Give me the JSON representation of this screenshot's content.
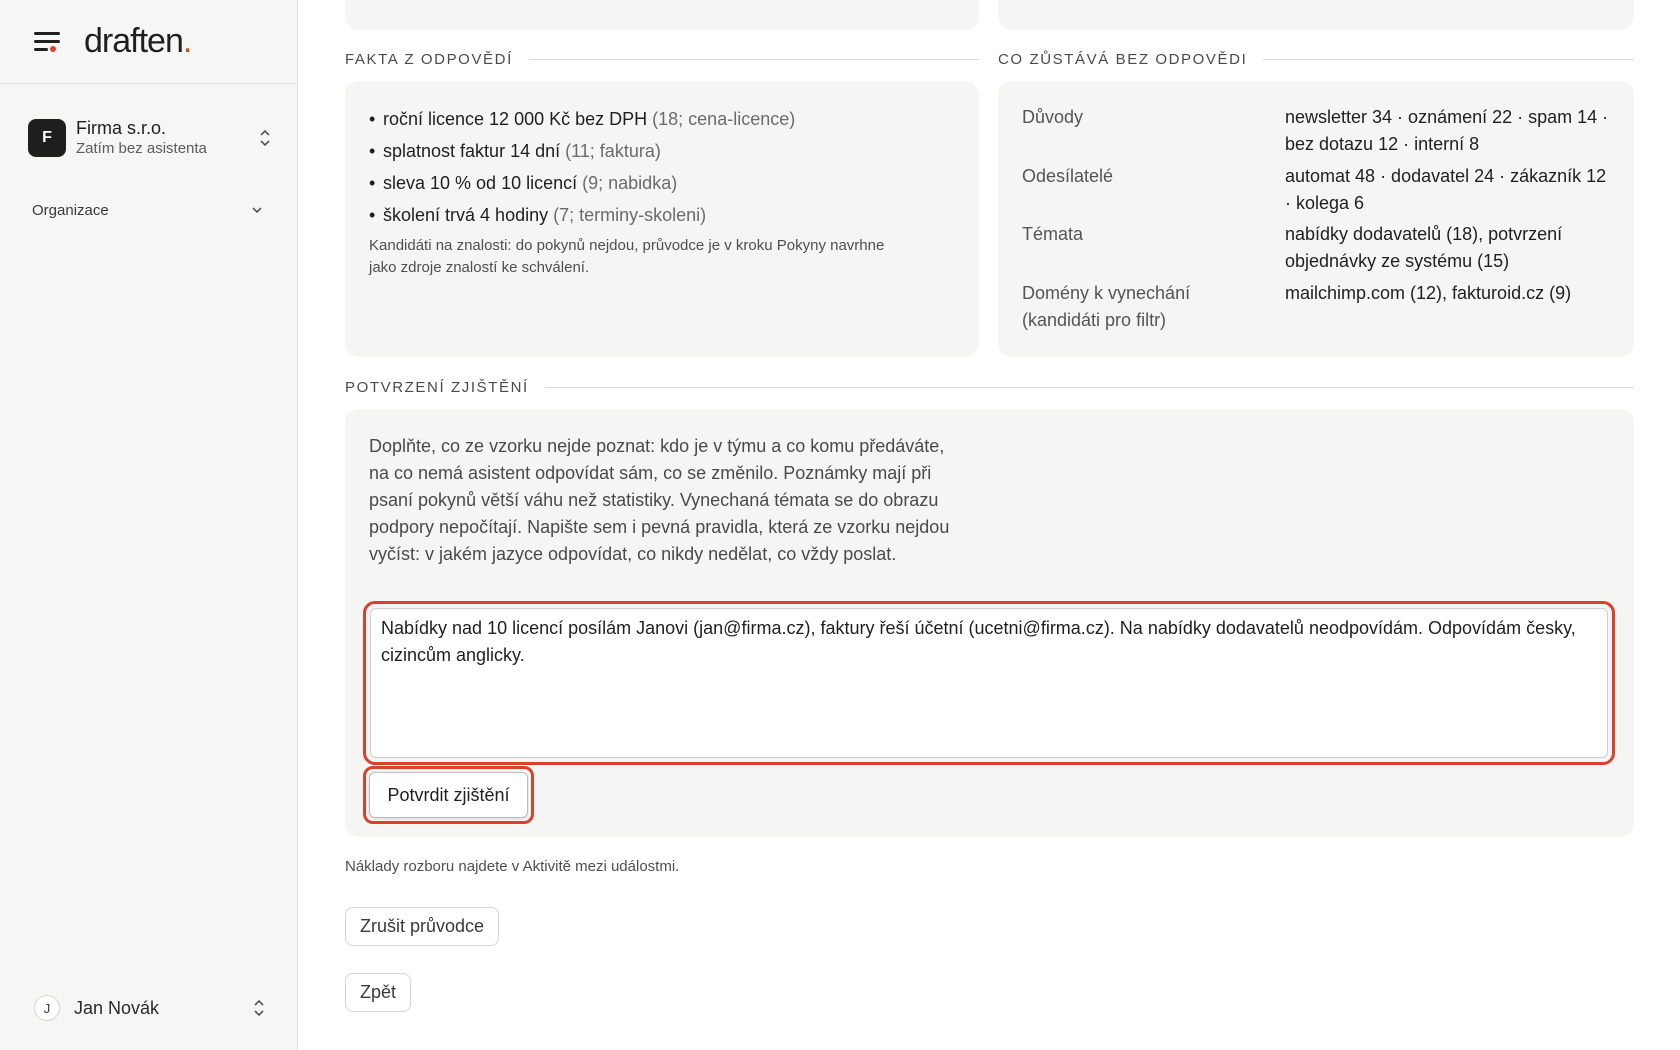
{
  "brand": {
    "logo_text": "draften",
    "logo_dot": "."
  },
  "sidebar": {
    "org_initial": "F",
    "org_name": "Firma s.r.o.",
    "org_sub": "Zatím bez asistenta",
    "section_label": "Organizace",
    "user_initial": "J",
    "user_name": "Jan Novák"
  },
  "facts": {
    "heading": "Fakta z odpovědí",
    "items": [
      {
        "text": "roční licence 12 000 Kč bez DPH",
        "meta": "(18; cena-licence)"
      },
      {
        "text": "splatnost faktur 14 dní",
        "meta": "(11; faktura)"
      },
      {
        "text": "sleva 10 % od 10 licencí",
        "meta": "(9; nabidka)"
      },
      {
        "text": "školení trvá 4 hodiny",
        "meta": "(7; terminy-skoleni)"
      }
    ],
    "note": "Kandidáti na znalosti: do pokynů nejdou, průvodce je v kroku Pokyny navrhne jako zdroje znalostí ke schválení."
  },
  "unanswered": {
    "heading": "Co zůstává bez odpovědi",
    "rows": [
      {
        "key": "Důvody",
        "value": "newsletter 34 · oznámení 22 · spam 14 · bez dotazu 12 · interní 8"
      },
      {
        "key": "Odesílatelé",
        "value": "automat 48 · dodavatel 24 · zákazník 12 · kolega 6"
      },
      {
        "key": "Témata",
        "value": "nabídky dodavatelů (18), potvrzení objednávky ze systému (15)"
      },
      {
        "key": "Domény k vynechání (kandidáti pro filtr)",
        "value": "mailchimp.com (12), fakturoid.cz (9)"
      }
    ]
  },
  "confirm": {
    "heading": "Potvrzení zjištění",
    "intro": "Doplňte, co ze vzorku nejde poznat: kdo je v týmu a co komu předáváte, na co nemá asistent odpovídat sám, co se změnilo. Poznámky mají při psaní pokynů větší váhu než statistiky. Vynechaná témata se do obrazu podpory nepočítají. Napište sem i pevná pravidla, která ze vzorku nejdou vyčíst: v jakém jazyce odpovídat, co nikdy nedělat, co vždy poslat.",
    "notes_value": "Nabídky nad 10 licencí posílám Janovi (jan@firma.cz), faktury řeší účetní (ucetni@firma.cz). Na nabídky dodavatelů neodpovídám. Odpovídám česky, cizincům anglicky.",
    "button_label": "Potvrdit zjištění"
  },
  "footer": {
    "cost_note": "Náklady rozboru najdete v Aktivitě mezi událostmi.",
    "cancel_label": "Zrušit průvodce",
    "back_label": "Zpět"
  },
  "colors": {
    "accent": "#e0452c",
    "highlight": "#d9412b",
    "card_bg": "#f5f5f4"
  }
}
